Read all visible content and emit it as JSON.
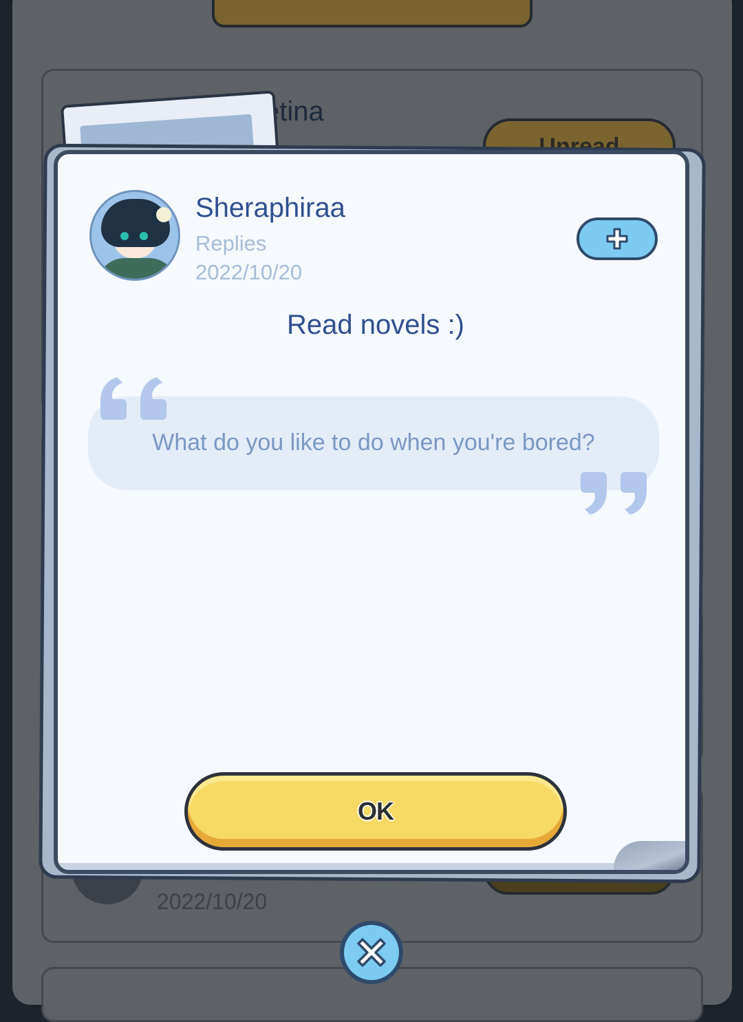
{
  "background": {
    "card_name_fragment": "etina",
    "unread_label": "Unread",
    "bottom_date": "2022/10/20"
  },
  "modal": {
    "user": {
      "name": "Sheraphiraa",
      "subtitle": "Replies",
      "date": "2022/10/20"
    },
    "reply": "Read novels :)",
    "question": "What do you like to do when you're bored?",
    "ok_label": "OK"
  },
  "icons": {
    "add": "plus-icon",
    "close": "close-icon",
    "quote_open": "open-quote-icon",
    "quote_close": "close-quote-icon"
  },
  "colors": {
    "accent_yellow": "#f7d965",
    "accent_blue": "#7dcbf0",
    "text_blue": "#2f4f8f",
    "muted_blue": "#a7bcd9"
  }
}
